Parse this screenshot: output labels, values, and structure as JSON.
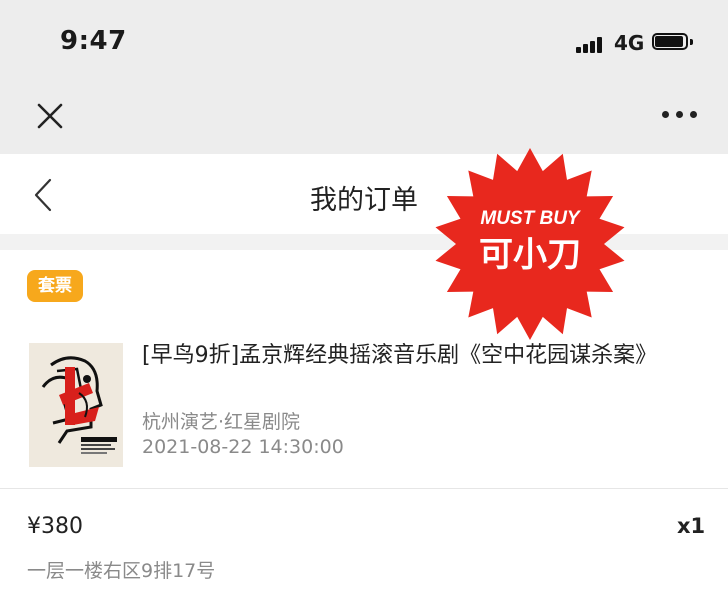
{
  "status_bar": {
    "time": "9:47",
    "network": "4G"
  },
  "nav": {
    "close_icon": "close-icon",
    "more_icon": "more-horizontal-icon"
  },
  "header": {
    "title": "我的订单",
    "back_icon": "chevron-left-icon"
  },
  "order": {
    "badge": "套票",
    "title": "[早鸟9折]孟京辉经典摇滚音乐剧《空中花园谋杀案》",
    "venue": "杭州演艺·红星剧院",
    "datetime": "2021-08-22 14:30:00",
    "price": "¥380",
    "quantity": "x1",
    "seat": "一层一楼右区9排17号"
  },
  "stamp": {
    "line1": "MUST BUY",
    "line2": "可小刀",
    "color": "#e8281e"
  },
  "colors": {
    "badge": "#f7a81c",
    "bar": "#ededed",
    "muted_text": "#8a8a8a"
  }
}
